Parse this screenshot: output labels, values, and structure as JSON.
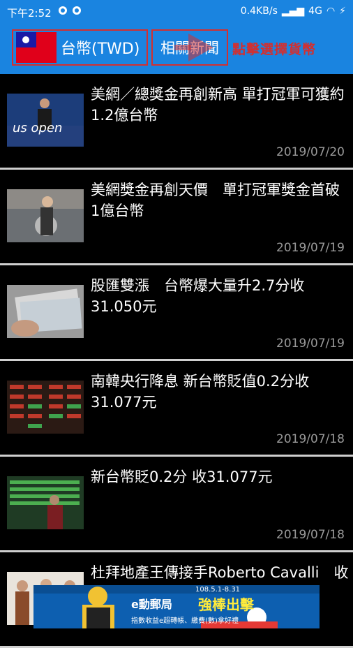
{
  "status_bar": {
    "time": "下午2:52",
    "speed": "0.4KB/s",
    "network": "4G"
  },
  "toolbar": {
    "currency_label": "台幣(TWD)",
    "related_news_label": "相關新聞",
    "hint": "點擊選擇貨幣"
  },
  "news": [
    {
      "title": "美網／總獎金再創新高 單打冠軍可獲約1.2億台幣",
      "date": "2019/07/20",
      "thumb": "tennis-player"
    },
    {
      "title": "美網獎金再創天價　單打冠軍獎金首破1億台幣",
      "date": "2019/07/19",
      "thumb": "tennis-trophy"
    },
    {
      "title": "股匯雙漲　台幣爆大量升2.7分收31.050元",
      "date": "2019/07/19",
      "thumb": "banknotes"
    },
    {
      "title": "南韓央行降息 新台幣貶值0.2分收31.077元",
      "date": "2019/07/18",
      "thumb": "stock-board"
    },
    {
      "title": "新台幣貶0.2分 收31.077元",
      "date": "2019/07/18",
      "thumb": "stock-board-person"
    },
    {
      "title": "杜拜地產王傳接手Roberto Cavalli　收購價57.6億台幣",
      "date": "",
      "thumb": "fashion-models"
    }
  ],
  "ad": {
    "date_range": "108.5.1-8.31",
    "headline": "強棒出擊",
    "brand": "e動郵局",
    "subtext": "指數收益e超轉帳、繳費(數)拿好禮"
  },
  "colors": {
    "primary": "#1a84e0",
    "highlight": "#d32f2f",
    "background": "#000000",
    "date_text": "#9a9a9a"
  }
}
